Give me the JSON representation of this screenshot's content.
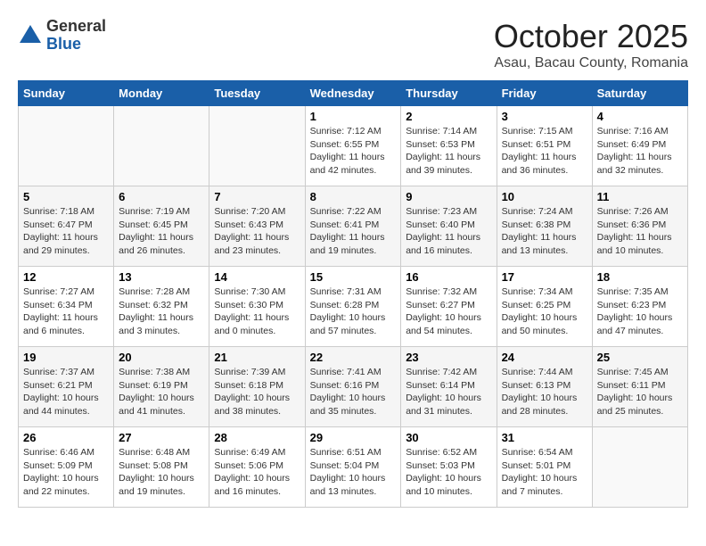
{
  "logo": {
    "general": "General",
    "blue": "Blue"
  },
  "title": "October 2025",
  "location": "Asau, Bacau County, Romania",
  "weekdays": [
    "Sunday",
    "Monday",
    "Tuesday",
    "Wednesday",
    "Thursday",
    "Friday",
    "Saturday"
  ],
  "weeks": [
    [
      {
        "day": "",
        "info": ""
      },
      {
        "day": "",
        "info": ""
      },
      {
        "day": "",
        "info": ""
      },
      {
        "day": "1",
        "info": "Sunrise: 7:12 AM\nSunset: 6:55 PM\nDaylight: 11 hours\nand 42 minutes."
      },
      {
        "day": "2",
        "info": "Sunrise: 7:14 AM\nSunset: 6:53 PM\nDaylight: 11 hours\nand 39 minutes."
      },
      {
        "day": "3",
        "info": "Sunrise: 7:15 AM\nSunset: 6:51 PM\nDaylight: 11 hours\nand 36 minutes."
      },
      {
        "day": "4",
        "info": "Sunrise: 7:16 AM\nSunset: 6:49 PM\nDaylight: 11 hours\nand 32 minutes."
      }
    ],
    [
      {
        "day": "5",
        "info": "Sunrise: 7:18 AM\nSunset: 6:47 PM\nDaylight: 11 hours\nand 29 minutes."
      },
      {
        "day": "6",
        "info": "Sunrise: 7:19 AM\nSunset: 6:45 PM\nDaylight: 11 hours\nand 26 minutes."
      },
      {
        "day": "7",
        "info": "Sunrise: 7:20 AM\nSunset: 6:43 PM\nDaylight: 11 hours\nand 23 minutes."
      },
      {
        "day": "8",
        "info": "Sunrise: 7:22 AM\nSunset: 6:41 PM\nDaylight: 11 hours\nand 19 minutes."
      },
      {
        "day": "9",
        "info": "Sunrise: 7:23 AM\nSunset: 6:40 PM\nDaylight: 11 hours\nand 16 minutes."
      },
      {
        "day": "10",
        "info": "Sunrise: 7:24 AM\nSunset: 6:38 PM\nDaylight: 11 hours\nand 13 minutes."
      },
      {
        "day": "11",
        "info": "Sunrise: 7:26 AM\nSunset: 6:36 PM\nDaylight: 11 hours\nand 10 minutes."
      }
    ],
    [
      {
        "day": "12",
        "info": "Sunrise: 7:27 AM\nSunset: 6:34 PM\nDaylight: 11 hours\nand 6 minutes."
      },
      {
        "day": "13",
        "info": "Sunrise: 7:28 AM\nSunset: 6:32 PM\nDaylight: 11 hours\nand 3 minutes."
      },
      {
        "day": "14",
        "info": "Sunrise: 7:30 AM\nSunset: 6:30 PM\nDaylight: 11 hours\nand 0 minutes."
      },
      {
        "day": "15",
        "info": "Sunrise: 7:31 AM\nSunset: 6:28 PM\nDaylight: 10 hours\nand 57 minutes."
      },
      {
        "day": "16",
        "info": "Sunrise: 7:32 AM\nSunset: 6:27 PM\nDaylight: 10 hours\nand 54 minutes."
      },
      {
        "day": "17",
        "info": "Sunrise: 7:34 AM\nSunset: 6:25 PM\nDaylight: 10 hours\nand 50 minutes."
      },
      {
        "day": "18",
        "info": "Sunrise: 7:35 AM\nSunset: 6:23 PM\nDaylight: 10 hours\nand 47 minutes."
      }
    ],
    [
      {
        "day": "19",
        "info": "Sunrise: 7:37 AM\nSunset: 6:21 PM\nDaylight: 10 hours\nand 44 minutes."
      },
      {
        "day": "20",
        "info": "Sunrise: 7:38 AM\nSunset: 6:19 PM\nDaylight: 10 hours\nand 41 minutes."
      },
      {
        "day": "21",
        "info": "Sunrise: 7:39 AM\nSunset: 6:18 PM\nDaylight: 10 hours\nand 38 minutes."
      },
      {
        "day": "22",
        "info": "Sunrise: 7:41 AM\nSunset: 6:16 PM\nDaylight: 10 hours\nand 35 minutes."
      },
      {
        "day": "23",
        "info": "Sunrise: 7:42 AM\nSunset: 6:14 PM\nDaylight: 10 hours\nand 31 minutes."
      },
      {
        "day": "24",
        "info": "Sunrise: 7:44 AM\nSunset: 6:13 PM\nDaylight: 10 hours\nand 28 minutes."
      },
      {
        "day": "25",
        "info": "Sunrise: 7:45 AM\nSunset: 6:11 PM\nDaylight: 10 hours\nand 25 minutes."
      }
    ],
    [
      {
        "day": "26",
        "info": "Sunrise: 6:46 AM\nSunset: 5:09 PM\nDaylight: 10 hours\nand 22 minutes."
      },
      {
        "day": "27",
        "info": "Sunrise: 6:48 AM\nSunset: 5:08 PM\nDaylight: 10 hours\nand 19 minutes."
      },
      {
        "day": "28",
        "info": "Sunrise: 6:49 AM\nSunset: 5:06 PM\nDaylight: 10 hours\nand 16 minutes."
      },
      {
        "day": "29",
        "info": "Sunrise: 6:51 AM\nSunset: 5:04 PM\nDaylight: 10 hours\nand 13 minutes."
      },
      {
        "day": "30",
        "info": "Sunrise: 6:52 AM\nSunset: 5:03 PM\nDaylight: 10 hours\nand 10 minutes."
      },
      {
        "day": "31",
        "info": "Sunrise: 6:54 AM\nSunset: 5:01 PM\nDaylight: 10 hours\nand 7 minutes."
      },
      {
        "day": "",
        "info": ""
      }
    ]
  ]
}
